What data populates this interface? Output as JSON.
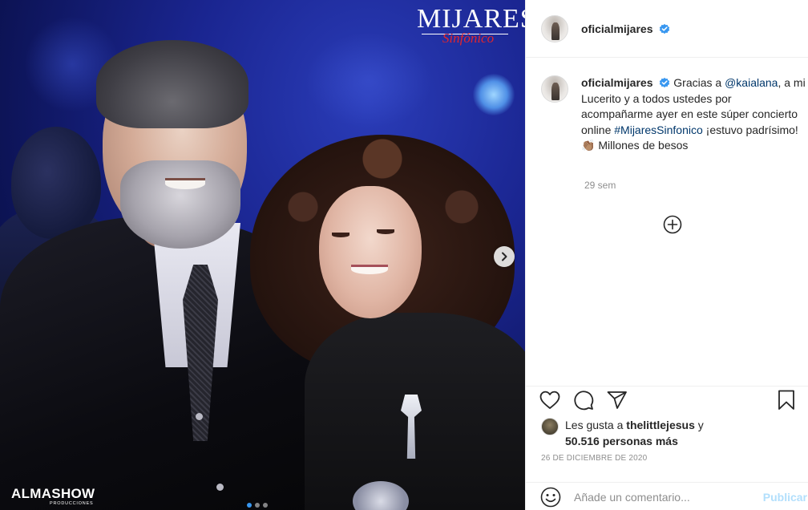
{
  "media": {
    "logo_title": "MIJARES",
    "logo_subtitle": "Sinfónico",
    "watermark": "ALMASHOW",
    "watermark_sub": "PRODUCCIONES",
    "carousel": {
      "count": 3,
      "active_index": 0
    }
  },
  "header": {
    "username": "oficialmijares",
    "verified": true
  },
  "caption": {
    "username": "oficialmijares",
    "text_1": " Gracias a ",
    "mention": "@kaialana",
    "text_2": ", a mi Lucerito y a todos ustedes por acompañarme ayer en este súper concierto online ",
    "hashtag": "#MijaresSinfonico",
    "text_3": " ¡estuvo padrísimo! ",
    "emoji": "👏🏽",
    "text_4": " Millones de besos",
    "time": "29 sem"
  },
  "likes": {
    "prefix": "Les gusta a ",
    "user": "thelittlejesus",
    "joiner": " y",
    "count_text": "50.516 personas más"
  },
  "date": "26 DE DICIEMBRE DE 2020",
  "comment": {
    "placeholder": "Añade un comentario...",
    "publish_label": "Publicar"
  },
  "colors": {
    "verified_blue": "#3897f0",
    "link_blue": "#00376b",
    "publish_disabled": "#b2dffc",
    "muted_text": "#8e8e8e"
  },
  "icons": [
    "heart-icon",
    "comment-icon",
    "share-icon",
    "bookmark-icon",
    "emoji-icon",
    "plus-circle-icon",
    "chevron-right-icon",
    "verified-badge-icon"
  ]
}
